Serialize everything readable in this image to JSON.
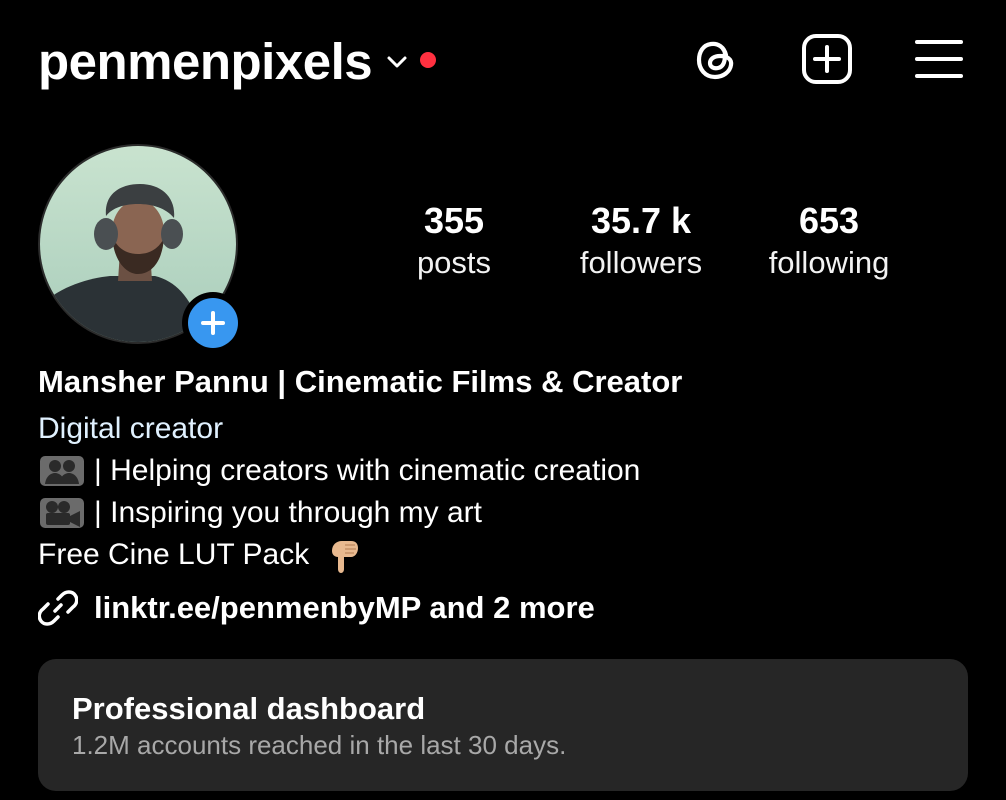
{
  "header": {
    "username": "penmenpixels",
    "icons": [
      "chevron-down-icon",
      "threads-icon",
      "add-post-icon",
      "hamburger-menu-icon"
    ]
  },
  "profile": {
    "stats": [
      {
        "value": "355",
        "label": "posts"
      },
      {
        "value": "35.7 k",
        "label": "followers"
      },
      {
        "value": "653",
        "label": "following"
      }
    ],
    "display_name": "Mansher Pannu | Cinematic Films & Creator",
    "category": "Digital creator",
    "bio_lines": [
      "| Helping creators with cinematic creation",
      "| Inspiring you through my art",
      "Free Cine LUT Pack"
    ],
    "bio_emoji": [
      "people-emoji",
      "movie-camera-emoji",
      "pointing-down-emoji"
    ],
    "link": "linktr.ee/penmenbyMP and 2 more"
  },
  "dashboard": {
    "title": "Professional dashboard",
    "subtitle": "1.2M accounts reached in the last 30 days."
  },
  "colors": {
    "background": "#000000",
    "text": "#ffffff",
    "category_text": "#e0f1ff",
    "notification_dot": "#ff3040",
    "add_story_blue": "#3897f0",
    "card_background": "#262626",
    "subtitle_text": "#a8a8a8"
  }
}
